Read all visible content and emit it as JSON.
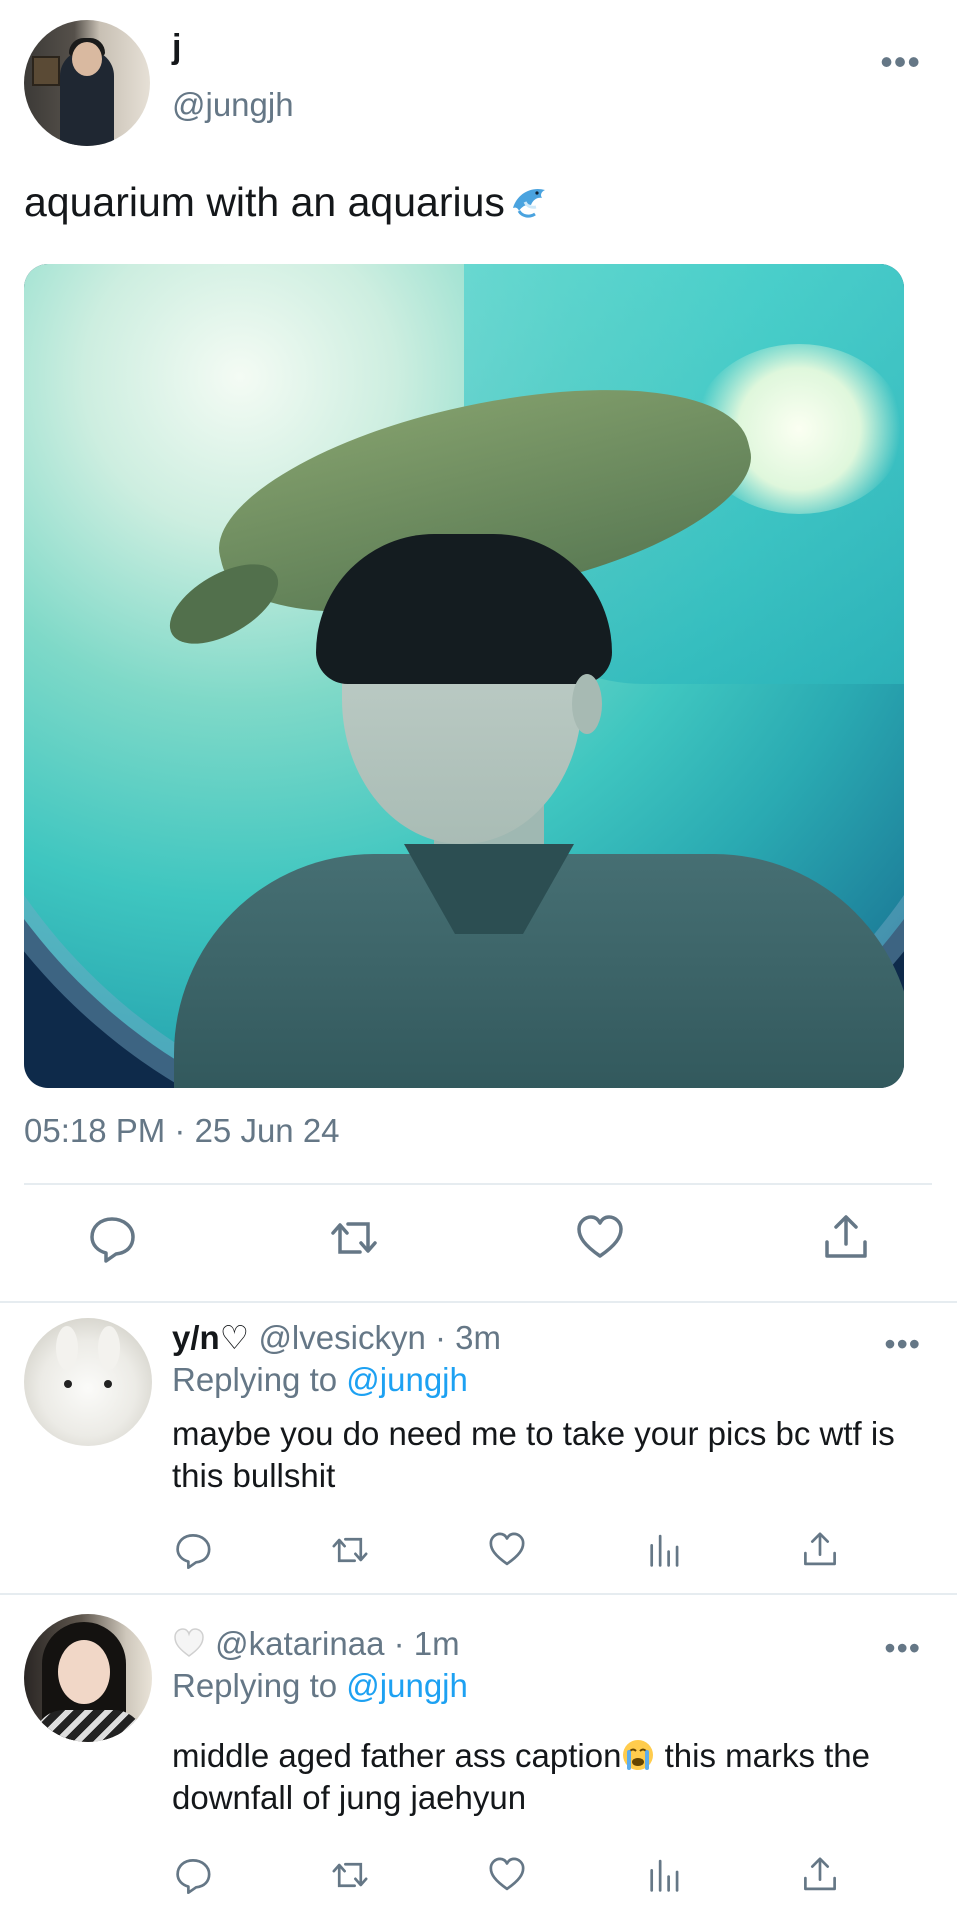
{
  "tweet": {
    "author_name": "j",
    "author_handle": "@jungjh",
    "more": "•••",
    "text": "aquarium with an aquarius",
    "text_emoji": "dolphin-icon",
    "timestamp": "05:18 PM · 25 Jun 24",
    "actions": [
      "reply-icon",
      "retweet-icon",
      "like-icon",
      "share-icon"
    ]
  },
  "replies": [
    {
      "name": "y/n♡",
      "handle": "@lvesickyn",
      "time": "· 3m",
      "replying_label": "Replying to",
      "replying_to": "@jungjh",
      "body": "maybe you do need me to take your pics bc wtf is this bullshit",
      "more": "•••"
    },
    {
      "name_emoji": "white-heart-icon",
      "handle": "@katarinaa",
      "time": "· 1m",
      "replying_label": "Replying to",
      "replying_to": "@jungjh",
      "body_part1": "middle aged father ass caption",
      "body_emoji": "crying-face-icon",
      "body_part2": " this marks the downfall of jung jaehyun",
      "more": "•••"
    }
  ],
  "colors": {
    "text": "#14171a",
    "secondary": "#657786",
    "link": "#1da1f2",
    "divider": "#e6ecf0"
  }
}
